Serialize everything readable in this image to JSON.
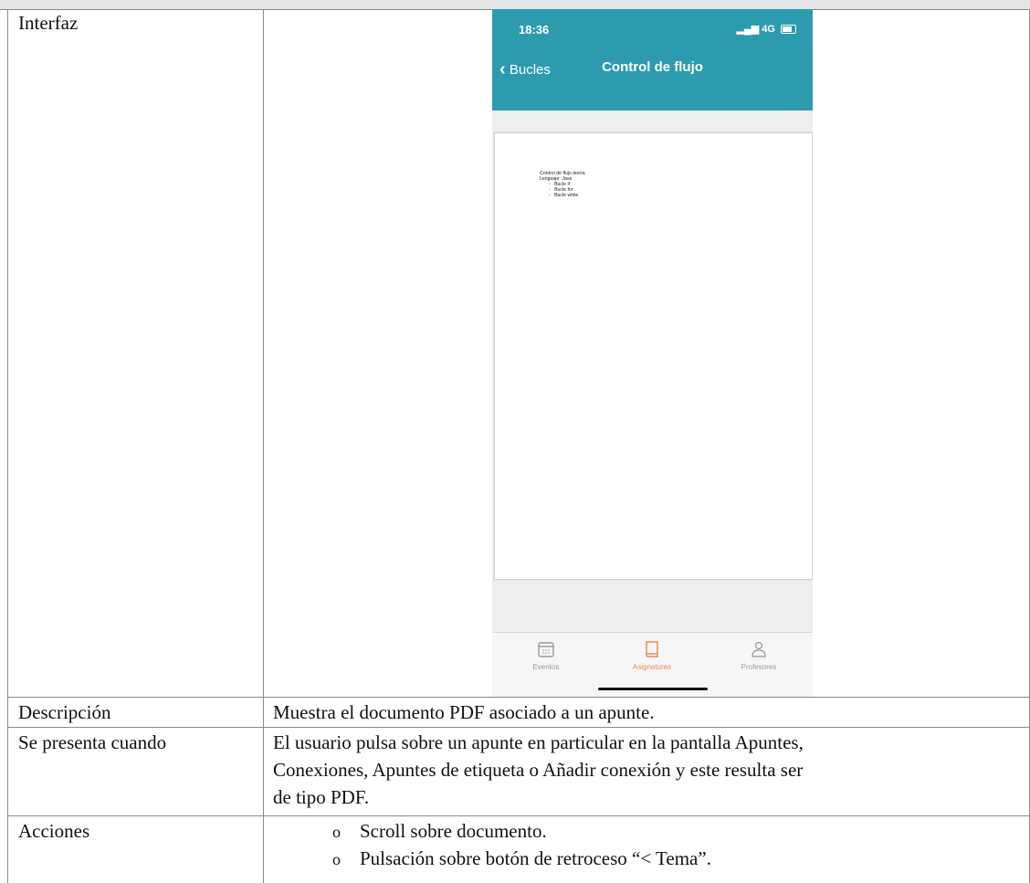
{
  "table": {
    "rows": [
      {
        "label": "Interfaz"
      },
      {
        "label": "Descripción",
        "text": "Muestra el documento PDF asociado a un apunte."
      },
      {
        "label": "Se presenta cuando",
        "lines": [
          "El usuario pulsa sobre un apunte en particular en la pantalla Apuntes,",
          "Conexiones, Apuntes de etiqueta o Añadir conexión y este resulta ser",
          "de tipo PDF."
        ]
      },
      {
        "label": "Acciones",
        "items": [
          "Scroll sobre documento.",
          "Pulsación sobre botón de retroceso “< Tema”."
        ]
      }
    ],
    "bullet": "o"
  },
  "phone": {
    "time": "18:36",
    "network": "4G",
    "back_label": "Bucles",
    "title": "Control de flujo",
    "pdf": {
      "title": "Control de flujo teoría",
      "language": "Lenguaje: Java",
      "items": [
        "Bucle if",
        "Bucle for",
        "Bucle while"
      ],
      "dash": "-"
    },
    "tabs": [
      {
        "label": "Eventos",
        "icon": "calendar-icon",
        "active": false
      },
      {
        "label": "Asignaturas",
        "icon": "book-icon",
        "active": true
      },
      {
        "label": "Profesores",
        "icon": "person-icon",
        "active": false
      }
    ],
    "colors": {
      "header": "#2c9bae",
      "active_tab": "#f08850",
      "inactive_tab": "#999999"
    }
  }
}
